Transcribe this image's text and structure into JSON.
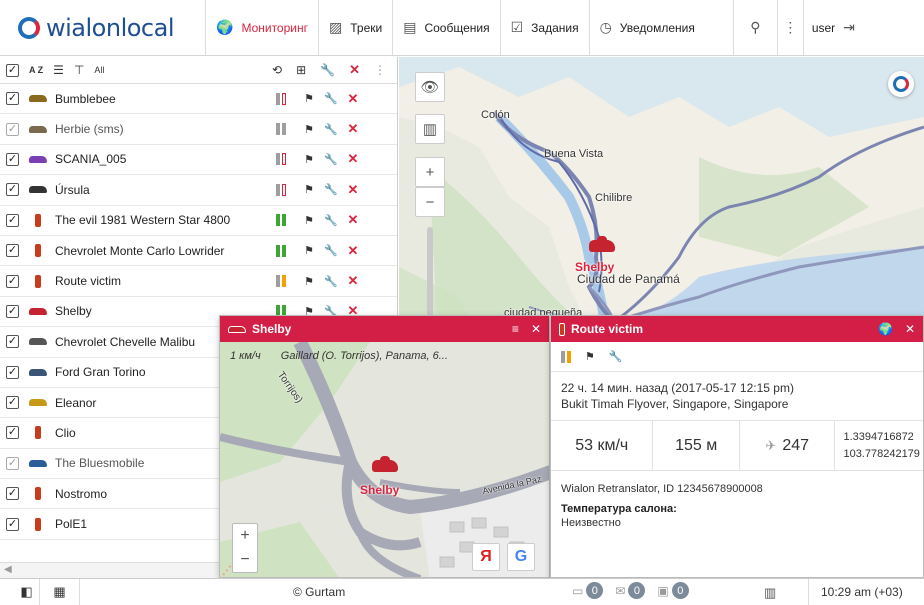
{
  "header": {
    "logo_text": "wialonlocal",
    "nav": [
      {
        "label": "Мониторинг",
        "icon": "globe-icon",
        "active": true
      },
      {
        "label": "Треки",
        "icon": "track-icon"
      },
      {
        "label": "Сообщения",
        "icon": "messages-icon"
      },
      {
        "label": "Задания",
        "icon": "tasks-icon"
      },
      {
        "label": "Уведомления",
        "icon": "notifications-icon"
      }
    ],
    "user": "user"
  },
  "toolbar": {
    "sort_label": "A Z",
    "all_label": "All"
  },
  "units": [
    {
      "name": "Bumblebee",
      "checked": true,
      "signal": "red"
    },
    {
      "name": "Herbie (sms)",
      "checked": true,
      "disabled": true,
      "signal": "grey"
    },
    {
      "name": "SCANIA_005",
      "checked": true,
      "signal": "red"
    },
    {
      "name": "Úrsula",
      "checked": true,
      "signal": "red"
    },
    {
      "name": "The evil 1981 Western Star 4800",
      "checked": true,
      "signal": "green"
    },
    {
      "name": "Chevrolet Monte Carlo Lowrider",
      "checked": true,
      "signal": "green"
    },
    {
      "name": "Route victim",
      "checked": true,
      "signal": "orange"
    },
    {
      "name": "Shelby",
      "checked": true,
      "signal": "green"
    },
    {
      "name": "Chevrolet Chevelle Malibu",
      "checked": true
    },
    {
      "name": "Ford Gran Torino",
      "checked": true
    },
    {
      "name": "Eleanor",
      "checked": true
    },
    {
      "name": "Clio",
      "checked": true
    },
    {
      "name": "The Bluesmobile",
      "checked": true,
      "disabled": true
    },
    {
      "name": "Nostromo",
      "checked": true
    },
    {
      "name": "PolE1",
      "checked": true
    }
  ],
  "map": {
    "labels": {
      "colon": "Colón",
      "buena_vista": "Buena Vista",
      "chilibre": "Chilibre",
      "panama": "Ciudad de Panamá",
      "pequena": "ciudad pequeña"
    },
    "unit_label": "Shelby"
  },
  "shelby_popup": {
    "title": "Shelby",
    "speed": "1 км/ч",
    "address": "Gaillard (O. Torrijos), Panama, 6...",
    "street_1": "Avenida la Paz",
    "street_2": "Torrijos)",
    "unit_label": "Shelby"
  },
  "route_popup": {
    "title": "Route victim",
    "time": "22 ч. 14 мин. назад (2017-05-17 12:15 pm)",
    "address": "Bukit Timah Flyover, Singapore, Singapore",
    "speed": "53 км/ч",
    "altitude": "155 м",
    "satellites": "247",
    "lat": "1.3394716872",
    "lon": "103.778242179",
    "device": "Wialon Retranslator, ID 12345678900008",
    "sensor_label": "Температура салона:",
    "sensor_value": "Неизвестно"
  },
  "footer": {
    "copyright": "© Gurtam",
    "counter1": "0",
    "counter2": "0",
    "counter3": "0",
    "clock": "10:29 am (+03)"
  },
  "colors": {
    "accent": "#d31f45",
    "brand_blue": "#1f4f92",
    "ok": "#3fa535",
    "warn": "#f2a100"
  }
}
